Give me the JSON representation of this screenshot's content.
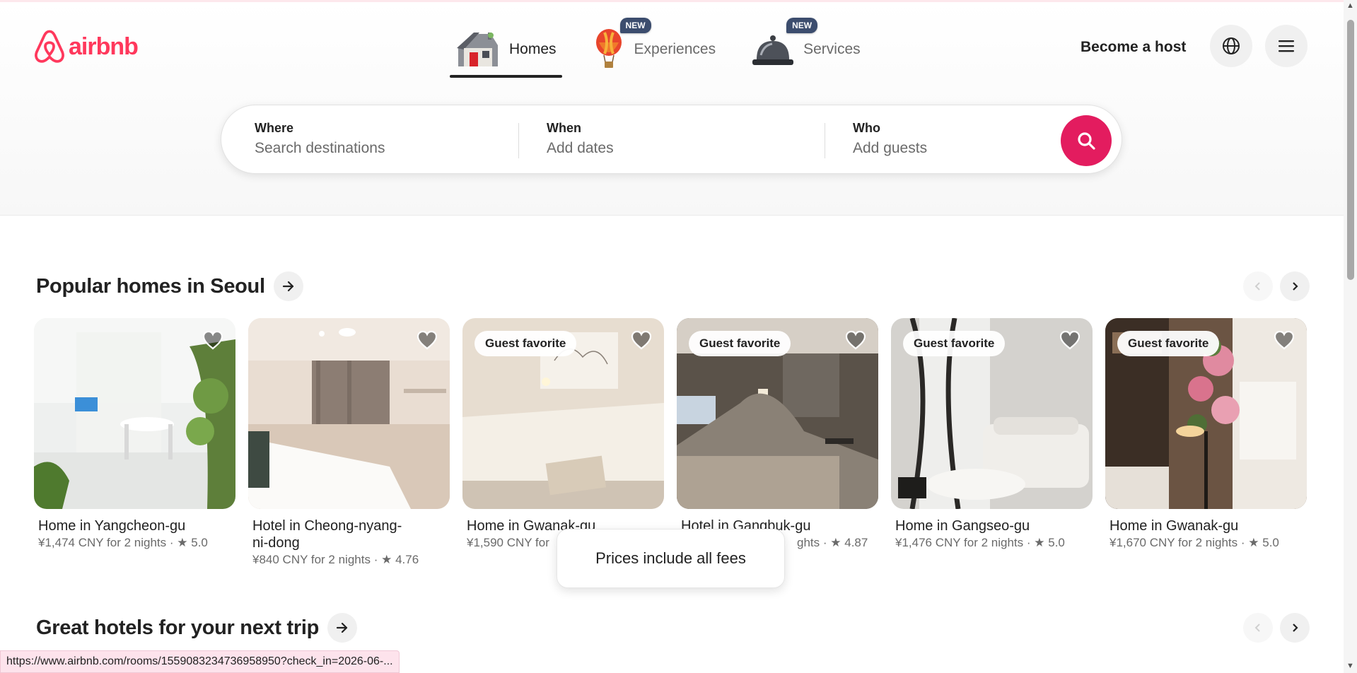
{
  "brand": {
    "name": "airbnb",
    "color": "#ff385c"
  },
  "nav": {
    "tabs": [
      {
        "label": "Homes",
        "active": true,
        "badge": "",
        "icon": "house-icon"
      },
      {
        "label": "Experiences",
        "active": false,
        "badge": "NEW",
        "icon": "hot-air-balloon-icon"
      },
      {
        "label": "Services",
        "active": false,
        "badge": "NEW",
        "icon": "service-bell-icon"
      }
    ],
    "host_link": "Become a host",
    "globe_icon": "globe-icon",
    "menu_icon": "hamburger-menu-icon"
  },
  "search": {
    "where": {
      "title": "Where",
      "placeholder": "Search destinations"
    },
    "when": {
      "title": "When",
      "placeholder": "Add dates"
    },
    "who": {
      "title": "Who",
      "placeholder": "Add guests"
    },
    "button_icon": "search-icon",
    "accent": "#e31c5f"
  },
  "sections": [
    {
      "title": "Popular homes in Seoul",
      "listings": [
        {
          "title": "Home in Yangcheon-gu",
          "price": "¥1,474 CNY for 2 nights",
          "rating": "5.0",
          "badge": ""
        },
        {
          "title": "Hotel in Cheong-nyang-ni-dong",
          "price": "¥840 CNY for 2 nights",
          "rating": "4.76",
          "badge": ""
        },
        {
          "title": "Home in Gwanak-gu",
          "price": "¥1,590 CNY for",
          "rating": "",
          "badge": "Guest favorite"
        },
        {
          "title": "Hotel in Gangbuk-gu",
          "price": "ghts",
          "rating": "4.87",
          "badge": "Guest favorite"
        },
        {
          "title": "Home in Gangseo-gu",
          "price": "¥1,476 CNY for 2 nights",
          "rating": "5.0",
          "badge": "Guest favorite"
        },
        {
          "title": "Home in Gwanak-gu",
          "price": "¥1,670 CNY for 2 nights",
          "rating": "5.0",
          "badge": "Guest favorite"
        }
      ]
    },
    {
      "title": "Great hotels for your next trip",
      "listings": []
    }
  ],
  "toast": "Prices include all fees",
  "status_url": "https://www.airbnb.com/rooms/1559083234736958950?check_in=2026-06-..."
}
